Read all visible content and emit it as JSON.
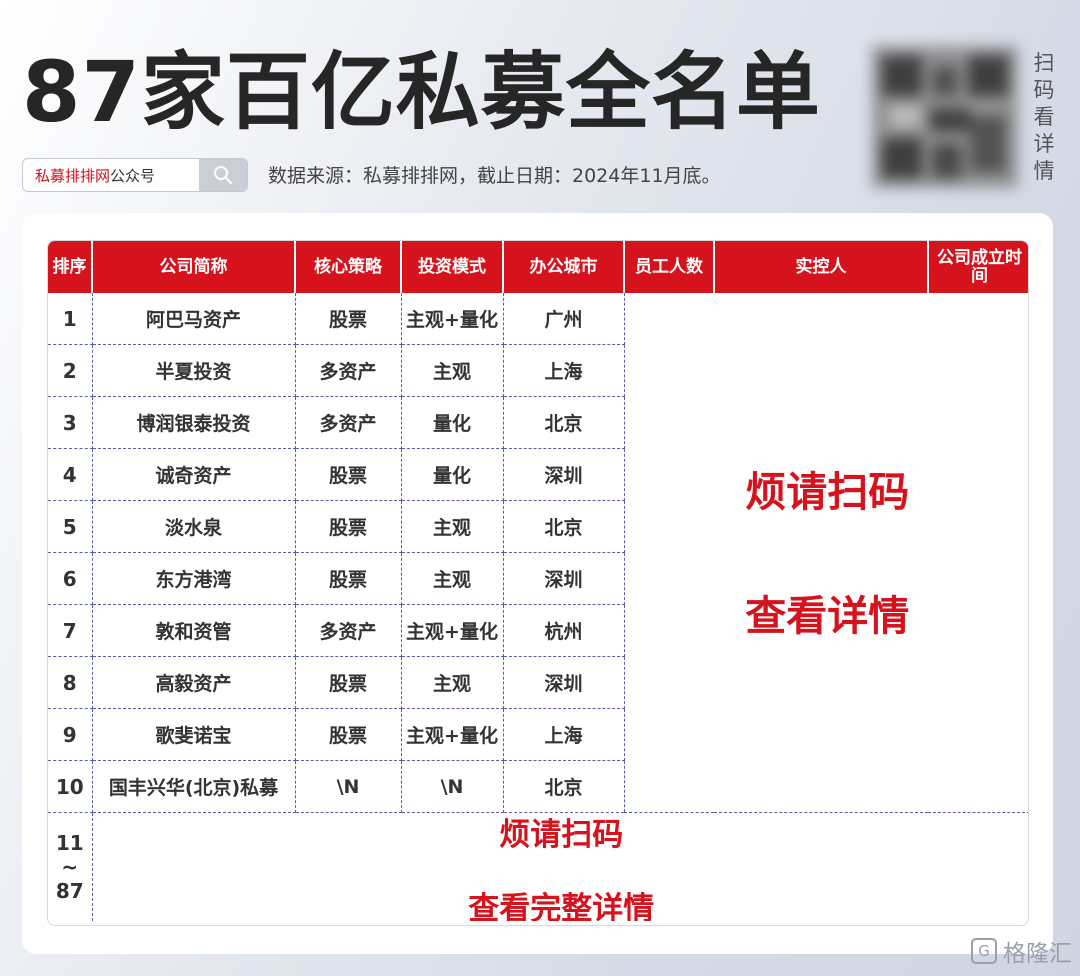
{
  "title": "87家百亿私募全名单",
  "search": {
    "brand": "私募排排网",
    "suffix": "公众号"
  },
  "source_text": "数据来源：私募排排网，截止日期：2024年11月底。",
  "scan_side_label": [
    "扫",
    "码",
    "看",
    "详",
    "情"
  ],
  "table": {
    "headers": [
      "排序",
      "公司简称",
      "核心策略",
      "投资模式",
      "办公城市",
      "员工人数",
      "实控人",
      "公司成立时间"
    ],
    "rows": [
      {
        "rank": "1",
        "name": "阿巴马资产",
        "strategy": "股票",
        "mode": "主观+量化",
        "city": "广州"
      },
      {
        "rank": "2",
        "name": "半夏投资",
        "strategy": "多资产",
        "mode": "主观",
        "city": "上海"
      },
      {
        "rank": "3",
        "name": "博润银泰投资",
        "strategy": "多资产",
        "mode": "量化",
        "city": "北京"
      },
      {
        "rank": "4",
        "name": "诚奇资产",
        "strategy": "股票",
        "mode": "量化",
        "city": "深圳"
      },
      {
        "rank": "5",
        "name": "淡水泉",
        "strategy": "股票",
        "mode": "主观",
        "city": "北京"
      },
      {
        "rank": "6",
        "name": "东方港湾",
        "strategy": "股票",
        "mode": "主观",
        "city": "深圳"
      },
      {
        "rank": "7",
        "name": "敦和资管",
        "strategy": "多资产",
        "mode": "主观+量化",
        "city": "杭州"
      },
      {
        "rank": "8",
        "name": "高毅资产",
        "strategy": "股票",
        "mode": "主观",
        "city": "深圳"
      },
      {
        "rank": "9",
        "name": "歌斐诺宝",
        "strategy": "股票",
        "mode": "主观+量化",
        "city": "上海"
      },
      {
        "rank": "10",
        "name": "国丰兴华(北京)私募",
        "strategy": "\\N",
        "mode": "\\N",
        "city": "北京"
      }
    ],
    "blank_prompt_line1": "烦请扫码",
    "blank_prompt_line2": "查看详情",
    "last_rank": "11\n~\n87",
    "last_prompt_line1": "烦请扫码",
    "last_prompt_line2": "查看完整详情"
  },
  "watermark": "格隆汇",
  "colors": {
    "accent_red": "#d6131d",
    "brand_red": "#d0121b"
  }
}
